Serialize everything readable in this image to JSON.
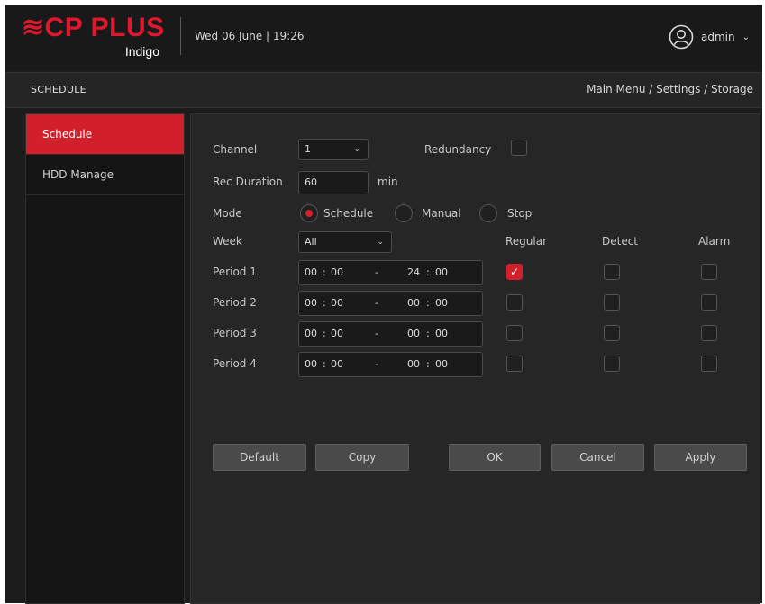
{
  "header": {
    "logo_main": "≋CP PLUS",
    "logo_sub": "Indigo",
    "datetime": "Wed 06 June | 19:26",
    "user": "admin"
  },
  "titlebar": {
    "title": "SCHEDULE",
    "breadcrumb": "Main Menu / Settings / Storage"
  },
  "sidebar": {
    "items": [
      {
        "label": "Schedule"
      },
      {
        "label": "HDD Manage"
      }
    ]
  },
  "form": {
    "channel_label": "Channel",
    "channel_value": "1",
    "redundancy_label": "Redundancy",
    "rec_duration_label": "Rec Duration",
    "rec_duration_value": "60",
    "rec_duration_unit": "min",
    "mode_label": "Mode",
    "mode_options": [
      "Schedule",
      "Manual",
      "Stop"
    ],
    "mode_selected": "Schedule",
    "week_label": "Week",
    "week_value": "All",
    "col_headers": [
      "Regular",
      "Detect",
      "Alarm"
    ],
    "periods": [
      {
        "label": "Period 1",
        "start_h": "00",
        "start_m": "00",
        "sep": "-",
        "end_h": "24",
        "end_m": "00",
        "regular": true,
        "detect": false,
        "alarm": false
      },
      {
        "label": "Period 2",
        "start_h": "00",
        "start_m": "00",
        "sep": "-",
        "end_h": "00",
        "end_m": "00",
        "regular": false,
        "detect": false,
        "alarm": false
      },
      {
        "label": "Period 3",
        "start_h": "00",
        "start_m": "00",
        "sep": "-",
        "end_h": "00",
        "end_m": "00",
        "regular": false,
        "detect": false,
        "alarm": false
      },
      {
        "label": "Period 4",
        "start_h": "00",
        "start_m": "00",
        "sep": "-",
        "end_h": "00",
        "end_m": "00",
        "regular": false,
        "detect": false,
        "alarm": false
      }
    ]
  },
  "buttons": {
    "default": "Default",
    "copy": "Copy",
    "ok": "OK",
    "cancel": "Cancel",
    "apply": "Apply"
  },
  "colors": {
    "accent": "#d11f2c",
    "brand": "#e0182d",
    "background": "#1c1c1c"
  }
}
